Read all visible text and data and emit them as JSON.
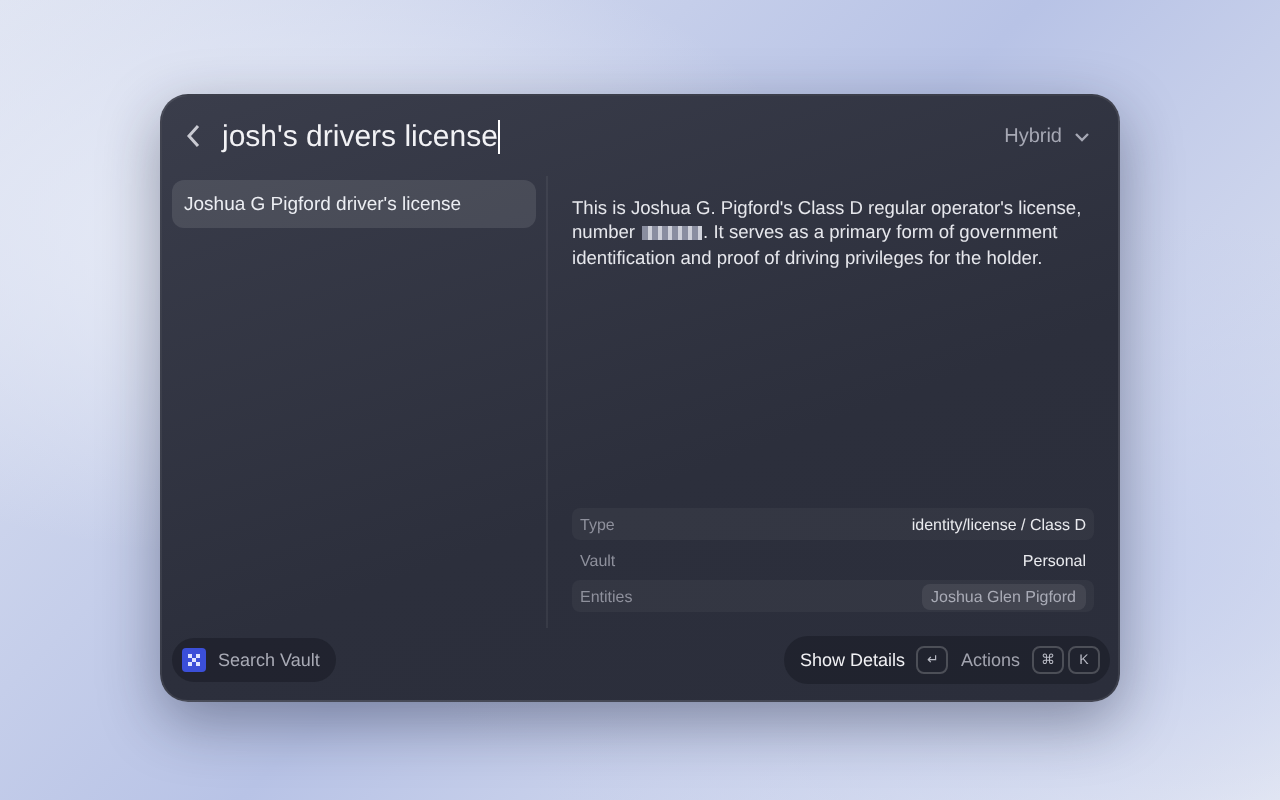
{
  "search": {
    "value": "josh's drivers license",
    "mode": "Hybrid"
  },
  "results": [
    {
      "title": "Joshua G Pigford driver's license",
      "selected": true
    }
  ],
  "detail": {
    "text_before": "This is Joshua G. Pigford's Class D regular operator's license, number",
    "text_after": ". It serves as a primary form of government identification and proof of driving privileges for the holder.",
    "fields": [
      {
        "label": "Type",
        "value": "identity/license / Class D",
        "kind": "plain"
      },
      {
        "label": "Vault",
        "value": "Personal",
        "kind": "plain"
      },
      {
        "label": "Entities",
        "value": "Joshua Glen Pigford",
        "kind": "chip"
      }
    ]
  },
  "footer": {
    "vault_button": "Search Vault",
    "primary_action": "Show Details",
    "primary_key": "↵",
    "secondary_action": "Actions",
    "keys": [
      "⌘",
      "K"
    ]
  }
}
